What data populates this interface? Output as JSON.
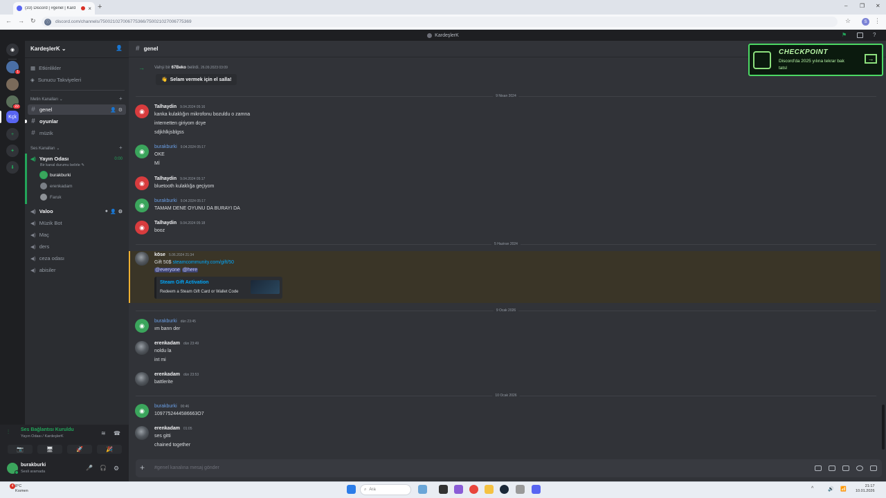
{
  "browser": {
    "tab_title": "(33) Discord | #genel | Kard",
    "tab_close": "×",
    "new_tab": "+",
    "url": "discord.com/channels/750021027006775366/750021027006775369",
    "window_controls": [
      "–",
      "❐",
      "✕"
    ],
    "nav_icons": [
      "back-icon",
      "forward-icon",
      "reload-icon"
    ],
    "profile_initial": "S",
    "star": "☆",
    "menu": "⋮"
  },
  "discord_titlebar": {
    "title": "KardeşlerK"
  },
  "rail": {
    "badges": [
      "1",
      "22"
    ],
    "selected_server": "Kçk",
    "icons": [
      "discord-home-icon",
      "add-server-icon",
      "discover-icon",
      "download-icon"
    ]
  },
  "sidebar": {
    "server_name": "KardeşlerK",
    "server_chevron": "⌄",
    "top_items": [
      {
        "label": "Etkinlikler",
        "icon": "calendar-icon"
      },
      {
        "label": "Sunucu Takviyeleri",
        "icon": "boost-icon"
      }
    ],
    "text_category": "Metin Kanalları",
    "text_channels": [
      {
        "name": "genel",
        "state": "active"
      },
      {
        "name": "oyunlar",
        "state": "unread"
      },
      {
        "name": "müzik",
        "state": "normal"
      }
    ],
    "voice_category": "Ses Kanalları",
    "voice_room": {
      "name": "Yayın Odası",
      "timer": "0:00",
      "status": "Bir kanal durumu belirle",
      "edit_glyph": "✎"
    },
    "voice_users": [
      {
        "name": "burakburki",
        "color": "#3ba55c",
        "speaking": true
      },
      {
        "name": "erenkadam",
        "color": "#7a7f86",
        "speaking": false
      },
      {
        "name": "Faruk",
        "color": "#8e9297",
        "speaking": false
      }
    ],
    "voice_channels": [
      {
        "name": "Valoo",
        "bold": true
      },
      {
        "name": "Müzik Bot",
        "bold": false
      },
      {
        "name": "Maç",
        "bold": false
      },
      {
        "name": "ders",
        "bold": false
      },
      {
        "name": "ceza odası",
        "bold": false
      },
      {
        "name": "abisiler",
        "bold": false
      }
    ],
    "glyphs": {
      "hash": "#",
      "speaker": "🔊",
      "plus": "+",
      "invite": "👤",
      "gear": "⚙",
      "chevron": "⌄"
    }
  },
  "voice_panel": {
    "status": "Ses Bağlantısı Kuruldu",
    "location": "Yayın Odası / KardeşlerK",
    "buttons": [
      "camera-off-icon",
      "screen-share-icon",
      "activities-icon",
      "soundboard-icon"
    ],
    "button_glyphs": [
      "📷",
      "🖥",
      "🚀",
      "🎉"
    ],
    "glyphs": {
      "signal": "📶",
      "noise": "≋",
      "disconnect": "☎"
    }
  },
  "user_panel": {
    "name": "burakburki",
    "status": "Sesli aramada",
    "glyphs": {
      "mic": "🎤",
      "headset": "🎧",
      "gear": "⚙"
    }
  },
  "chat": {
    "channel": "genel",
    "hash": "#",
    "system": {
      "arrow": "→",
      "text_before": "Vahşi bir",
      "user": "67Beko",
      "text_after": "belirdi.",
      "ts": "26.09.2023 03:09",
      "wave_label": "Selam vermek için el salla!",
      "wave_glyph": "👋"
    },
    "separators": [
      "9 Nisan 2024",
      "5 Haziran 2024",
      "9 Ocak 2026",
      "10 Ocak 2026"
    ],
    "messages": [
      {
        "author": "Talhaydin",
        "ts": "9.04.2024 05:16",
        "avatar": "red",
        "lines": [
          "kanka kulaklığın mikrofonu bozuldu o zamna",
          "internetten giriyom dcye",
          "sdjkhlkjsblgss"
        ]
      },
      {
        "author": "burakburki",
        "ts": "9.04.2024 05:17",
        "avatar": "green",
        "lines": [
          "OKE",
          "Mİ"
        ]
      },
      {
        "author": "Talhaydin",
        "ts": "9.04.2024 05:17",
        "avatar": "red",
        "lines": [
          "bluetooth kulaklığa geçiyom"
        ]
      },
      {
        "author": "burakburki",
        "ts": "9.04.2024 05:17",
        "avatar": "green",
        "lines": [
          "TAMAM DENE OYUNU DA BURAYI DA"
        ]
      },
      {
        "author": "Talhaydin",
        "ts": "9.04.2024 05:18",
        "avatar": "red",
        "lines": [
          "booz"
        ]
      },
      {
        "author": "köse",
        "ts": "5.06.2024 21:34",
        "avatar": "photo",
        "gift_prefix": "Gift 50$",
        "gift_link": "steamcommunity.com/gift/50",
        "mentions": [
          "@everyone",
          "@here"
        ]
      },
      {
        "author": "burakburki",
        "ts": "dün 23:45",
        "avatar": "green",
        "lines": [
          "ım bann der"
        ]
      },
      {
        "author": "erenkadam",
        "ts": "dün 23:49",
        "avatar": "photo",
        "lines": [
          "noldu la",
          "int mi"
        ]
      },
      {
        "author": "erenkadam",
        "ts": "dün 23:53",
        "avatar": "photo",
        "lines": [
          "battlerite"
        ]
      },
      {
        "author": "burakburki",
        "ts": "00:46",
        "avatar": "green",
        "lines": [
          "1097752444586663O7"
        ]
      },
      {
        "author": "erenkadam",
        "ts": "01:05",
        "avatar": "photo",
        "lines": [
          "ses gitti",
          "chained together"
        ]
      }
    ],
    "embed": {
      "title": "Steam Gift Activation",
      "description": "Redeem a Steam Gift Card or Wallet Code"
    },
    "composer_placeholder": "#genel kanalına mesaj gönder",
    "composer_plus": "+",
    "composer_icons": [
      "gift-icon",
      "gif-icon",
      "sticker-icon",
      "emoji-icon",
      "apps-icon"
    ]
  },
  "checkpoint": {
    "title": "CHECKPOINT",
    "subtitle": "Discord'da 2025 yılına tekrar bak",
    "subtitle2": "tatsl",
    "arrow": "→"
  },
  "taskbar": {
    "notif_count": "4",
    "weather_temp": "8°C",
    "weather_desc": "Kısmen",
    "search_placeholder": "Ara",
    "search_glyph": "⌕",
    "time": "21:17",
    "date": "10.01.2026",
    "apps": [
      "start-icon",
      "search-bar",
      "landscape-widget-icon",
      "task-view-icon",
      "copilot-icon",
      "chrome-icon",
      "file-explorer-icon",
      "steam-icon",
      "help-icon",
      "discord-taskbar-icon"
    ],
    "tray_glyphs": [
      "^",
      "🔊",
      "📶"
    ]
  }
}
